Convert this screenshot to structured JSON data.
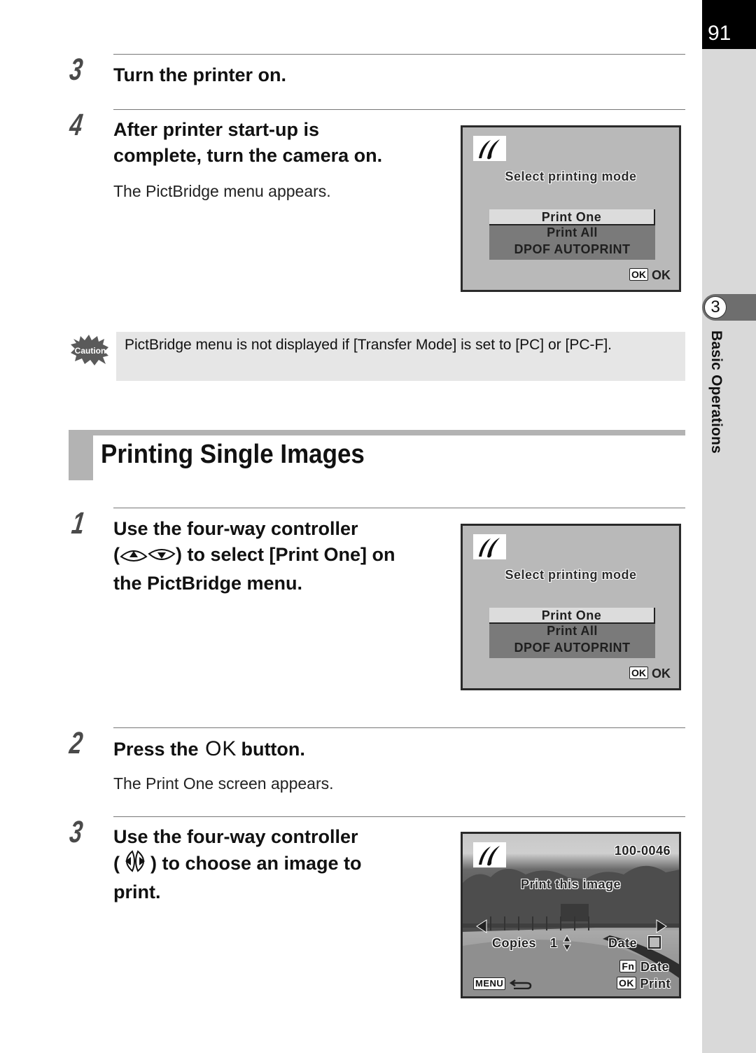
{
  "page": {
    "number": "91",
    "chapter_number": "3",
    "chapter_label": "Basic Operations"
  },
  "top_steps": [
    {
      "number": "3",
      "heading": "Turn the printer on."
    },
    {
      "number": "4",
      "heading_line1": "After printer start-up is",
      "heading_line2": "complete, turn the camera on.",
      "body": "The PictBridge menu appears."
    }
  ],
  "caution": {
    "icon_label": "Caution",
    "text": "PictBridge menu is not displayed if [Transfer Mode] is set to [PC] or [PC-F]."
  },
  "section": {
    "title": "Printing Single Images"
  },
  "steps": [
    {
      "number": "1",
      "line1": "Use the four-way controller",
      "line2_suffix": ") to select [Print One] on",
      "line3": "the PictBridge menu.",
      "controls": [
        "up-button-icon",
        "down-button-icon"
      ]
    },
    {
      "number": "2",
      "prefix": "Press the",
      "ok": "OK",
      "suffix": "button.",
      "body": "The Print One screen appears."
    },
    {
      "number": "3",
      "line1": "Use the four-way controller",
      "line2_suffix": ") to choose an image to",
      "line3": "print.",
      "controls": [
        "left-button-icon",
        "right-button-icon"
      ]
    }
  ],
  "screens": {
    "select_mode": {
      "title": "Select printing mode",
      "options": [
        "Print One",
        "Print All",
        "DPOF AUTOPRINT"
      ],
      "selected": "Print One",
      "ok_key": "OK",
      "ok_label": "OK"
    },
    "print_one": {
      "file_number": "100-0046",
      "title": "Print this image",
      "copies_label": "Copies",
      "copies_value": "1",
      "date_label": "Date",
      "date_checked": false,
      "fn_key": "Fn",
      "fn_label": "Date",
      "menu_key": "MENU",
      "ok_key": "OK",
      "ok_label": "Print"
    }
  }
}
